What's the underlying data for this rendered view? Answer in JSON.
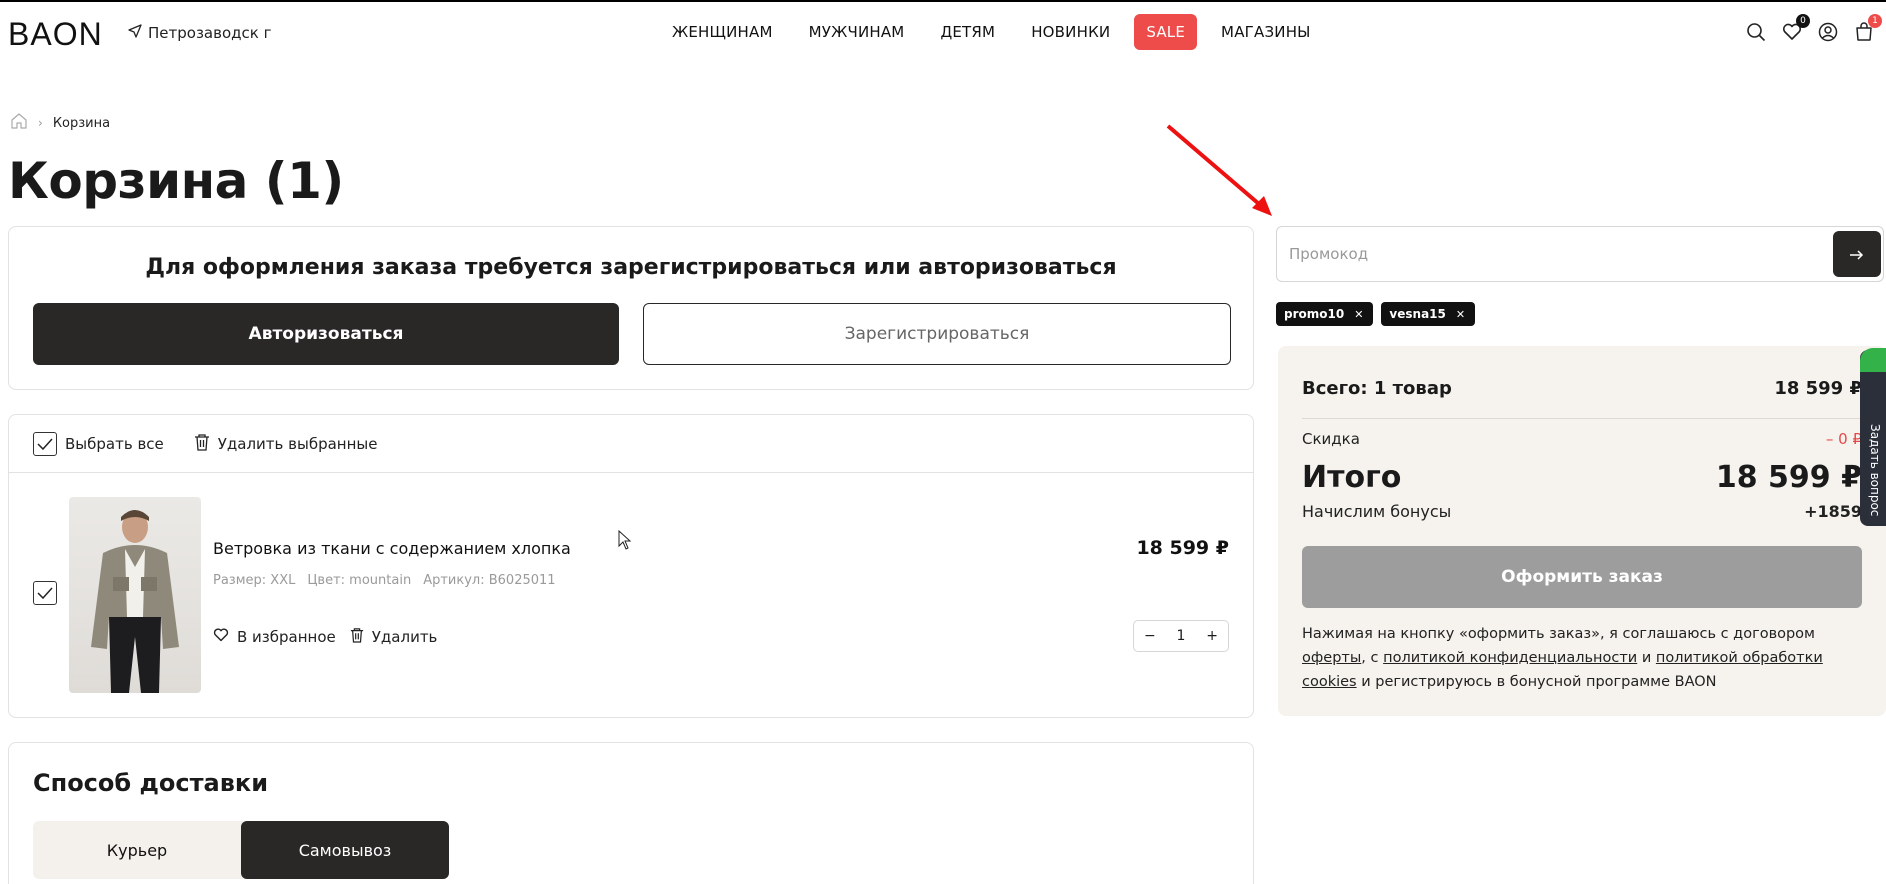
{
  "header": {
    "logo": "BAON",
    "city": "Петрозаводск г",
    "nav": [
      "ЖЕНЩИНАМ",
      "МУЖЧИНАМ",
      "ДЕТЯМ",
      "НОВИНКИ",
      "SALE",
      "МАГАЗИНЫ"
    ],
    "favorites_count": "0",
    "cart_count": "1",
    "sale_color": "#ee4b4b"
  },
  "breadcrumb": {
    "current": "Корзина"
  },
  "page_title": "Корзина (1)",
  "auth": {
    "title": "Для оформления заказа требуется зарегистрироваться или авторизоваться",
    "login": "Авторизоваться",
    "register": "Зарегистрироваться"
  },
  "cart": {
    "select_all": "Выбрать все",
    "delete_selected": "Удалить выбранные",
    "item": {
      "name": "Ветровка из ткани с содержанием хлопка",
      "size": "Размер: XXL",
      "color": "Цвет: mountain",
      "sku": "Артикул: B6025011",
      "price": "18 599 ₽",
      "favorite": "В избранное",
      "delete": "Удалить",
      "qty": "1"
    }
  },
  "delivery": {
    "title": "Способ доставки",
    "tabs": [
      "Курьер",
      "Самовывоз"
    ]
  },
  "promo": {
    "placeholder": "Промокод",
    "chips": [
      "promo10",
      "vesna15"
    ]
  },
  "summary": {
    "total_label": "Всего: 1 товар",
    "total_value": "18 599 ₽",
    "discount_label": "Скидка",
    "discount_value": "– 0 ₽",
    "grand_label": "Итого",
    "grand_value": "18 599 ₽",
    "bonus_label": "Начислим бонусы",
    "bonus_value": "+1859",
    "checkout": "Оформить заказ",
    "legal_1": "Нажимая на кнопку «оформить заказ», я соглашаюсь с договором ",
    "legal_link1": "оферты",
    "legal_2": ", с ",
    "legal_link2": "политикой конфиденциальности",
    "legal_3": " и ",
    "legal_link3": "политикой обработки cookies",
    "legal_4": " и регистрируюсь в бонусной программе BAON"
  },
  "ask_question": "Задать вопрос"
}
